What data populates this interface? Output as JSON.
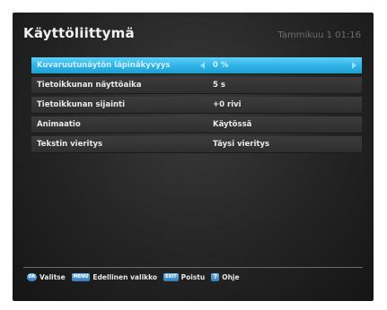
{
  "header": {
    "title": "Käyttöliittymä",
    "datetime": "Tammikuu 1 01:16"
  },
  "menu": {
    "items": [
      {
        "label": "Kuvaruutunäytön läpinäkyvyys",
        "value": "0 %",
        "selected": true
      },
      {
        "label": "Tietoikkunan näyttöaika",
        "value": "5 s",
        "selected": false
      },
      {
        "label": "Tietoikkunan sijainti",
        "value": "+0 rivi",
        "selected": false
      },
      {
        "label": "Animaatio",
        "value": "Käytössä",
        "selected": false
      },
      {
        "label": "Tekstin vieritys",
        "value": "Täysi vieritys",
        "selected": false
      }
    ]
  },
  "footer": {
    "ok_key": "OK",
    "ok_label": "Valitse",
    "menu_key": "MENU",
    "menu_label": "Edellinen valikko",
    "exit_key": "EXIT",
    "exit_label": "Poistu",
    "help_key": "?",
    "help_label": "Ohje"
  },
  "colors": {
    "selection": "#2fb2e6",
    "background": "#242424",
    "key_blue": "#3579b8"
  }
}
